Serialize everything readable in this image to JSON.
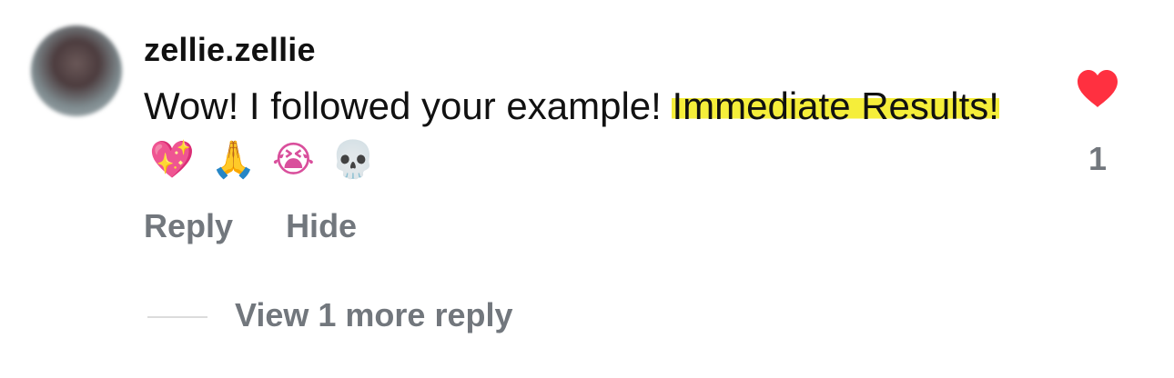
{
  "comment": {
    "username": "zellie.zellie",
    "text_plain": "Wow! I followed your example! ",
    "text_highlighted": "Immediate Results!",
    "emojis": [
      "💖",
      "🙏",
      "😭",
      "💀"
    ],
    "like_count": "1",
    "liked": true,
    "heart_color": "#ff3040",
    "highlight_color": "#f5ee3a",
    "actions": {
      "reply": "Reply",
      "hide": "Hide"
    },
    "view_more": "View 1 more reply"
  }
}
